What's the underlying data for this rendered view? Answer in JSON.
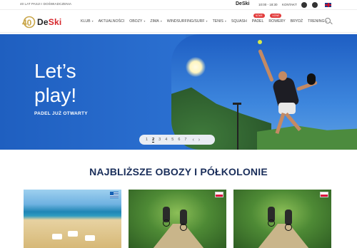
{
  "topbar": {
    "tagline": "40 LAT PASJI I DOŚWIADCZENIA",
    "brand": "DeSki",
    "hours": "10:00 - 18:30",
    "contact": "KONTAKT",
    "social": [
      "facebook-icon",
      "instagram-icon"
    ],
    "language_flag": "uk-flag-icon"
  },
  "logo": {
    "badge": "40",
    "word_left": "De",
    "word_right": "Ski"
  },
  "menu": [
    {
      "label": "KLUB",
      "caret": true
    },
    {
      "label": "AKTUALNOŚCI",
      "caret": false
    },
    {
      "label": "OBOZY",
      "caret": true
    },
    {
      "label": "ZIMA",
      "caret": true
    },
    {
      "label": "WINDSURFING/SURF",
      "caret": true
    },
    {
      "label": "TENIS",
      "caret": true
    },
    {
      "label": "SQUASH",
      "caret": false
    },
    {
      "label": "PADEL",
      "caret": false,
      "badge": "NOWE"
    },
    {
      "label": "ROWERY",
      "caret": false,
      "badge": "NOWE"
    },
    {
      "label": "BRYDŻ",
      "caret": false
    },
    {
      "label": "TRENING",
      "caret": true
    }
  ],
  "hero": {
    "title_line1": "Let’s",
    "title_line2": "play!",
    "subtitle": "PADEL JUŻ OTWARTY",
    "pager": [
      "1",
      "2",
      "3",
      "4",
      "5",
      "6",
      "7"
    ],
    "active_page": "2"
  },
  "section": {
    "title": "NAJBLIŻSZE OBOZY I PÓŁKOLONIE"
  },
  "cards": [
    {
      "name": "beach-camp-card",
      "flag": "greece-flag-icon"
    },
    {
      "name": "bike-camp-card-1",
      "flag": "poland-flag-icon"
    },
    {
      "name": "bike-camp-card-2",
      "flag": "poland-flag-icon"
    }
  ],
  "colors": {
    "accent": "#d6252a",
    "hero_blue": "#2a6dc9",
    "heading": "#1a2e5a"
  }
}
